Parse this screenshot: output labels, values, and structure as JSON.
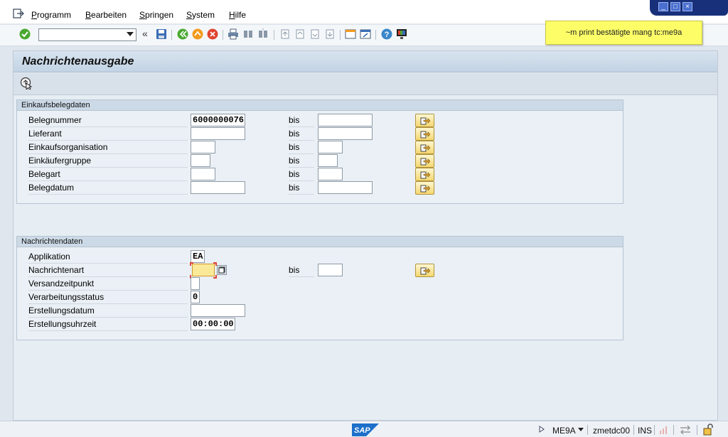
{
  "menu": {
    "items": [
      {
        "label": "Programm",
        "accel": "P",
        "rest": "rogramm"
      },
      {
        "label": "Bearbeiten",
        "accel": "B",
        "rest": "earbeiten"
      },
      {
        "label": "Springen",
        "accel": "S",
        "rest": "pringen"
      },
      {
        "label": "System",
        "accel": "S",
        "rest": "ystem"
      },
      {
        "label": "Hilfe",
        "accel": "H",
        "rest": "ilfe"
      }
    ]
  },
  "toolbar": {
    "command_value": "",
    "icons": [
      "enter-icon",
      "back-icon",
      "save-icon",
      "back-green-icon",
      "exit-icon",
      "cancel-icon",
      "print-icon",
      "find-icon",
      "find-next-icon",
      "first-page-icon",
      "prev-page-icon",
      "next-page-icon",
      "last-page-icon",
      "new-session-icon",
      "shortcut-icon",
      "help-icon",
      "customize-icon"
    ]
  },
  "note": {
    "text": "~m print bestätigte mang tc:me9a"
  },
  "screen": {
    "title": "Nachrichtenausgabe"
  },
  "einkauf": {
    "header": "Einkaufsbelegdaten",
    "bis_label": "bis",
    "rows": [
      {
        "label": "Belegnummer",
        "from": "6000000076",
        "to": ""
      },
      {
        "label": "Lieferant",
        "from": "",
        "to": ""
      },
      {
        "label": "Einkaufsorganisation",
        "from": "",
        "to": ""
      },
      {
        "label": "Einkäufergruppe",
        "from": "",
        "to": ""
      },
      {
        "label": "Belegart",
        "from": "",
        "to": ""
      },
      {
        "label": "Belegdatum",
        "from": "",
        "to": ""
      }
    ]
  },
  "nachricht": {
    "header": "Nachrichtendaten",
    "bis_label": "bis",
    "rows": [
      {
        "label": "Applikation",
        "value": "EA"
      },
      {
        "label": "Nachrichtenart",
        "value": "",
        "to": ""
      },
      {
        "label": "Versandzeitpunkt",
        "value": ""
      },
      {
        "label": "Verarbeitungsstatus",
        "value": "0"
      },
      {
        "label": "Erstellungsdatum",
        "value": ""
      },
      {
        "label": "Erstellungsuhrzeit",
        "value": "00:00:00"
      }
    ]
  },
  "status": {
    "transaction": "ME9A",
    "server": "zmetdc00",
    "mode": "INS",
    "logo_text": "SAP"
  },
  "colors": {
    "note_bg": "#fdfd68",
    "title_bar": "#c2d3e5",
    "select_button": "#f5d770",
    "window_controls": "#18307a"
  }
}
